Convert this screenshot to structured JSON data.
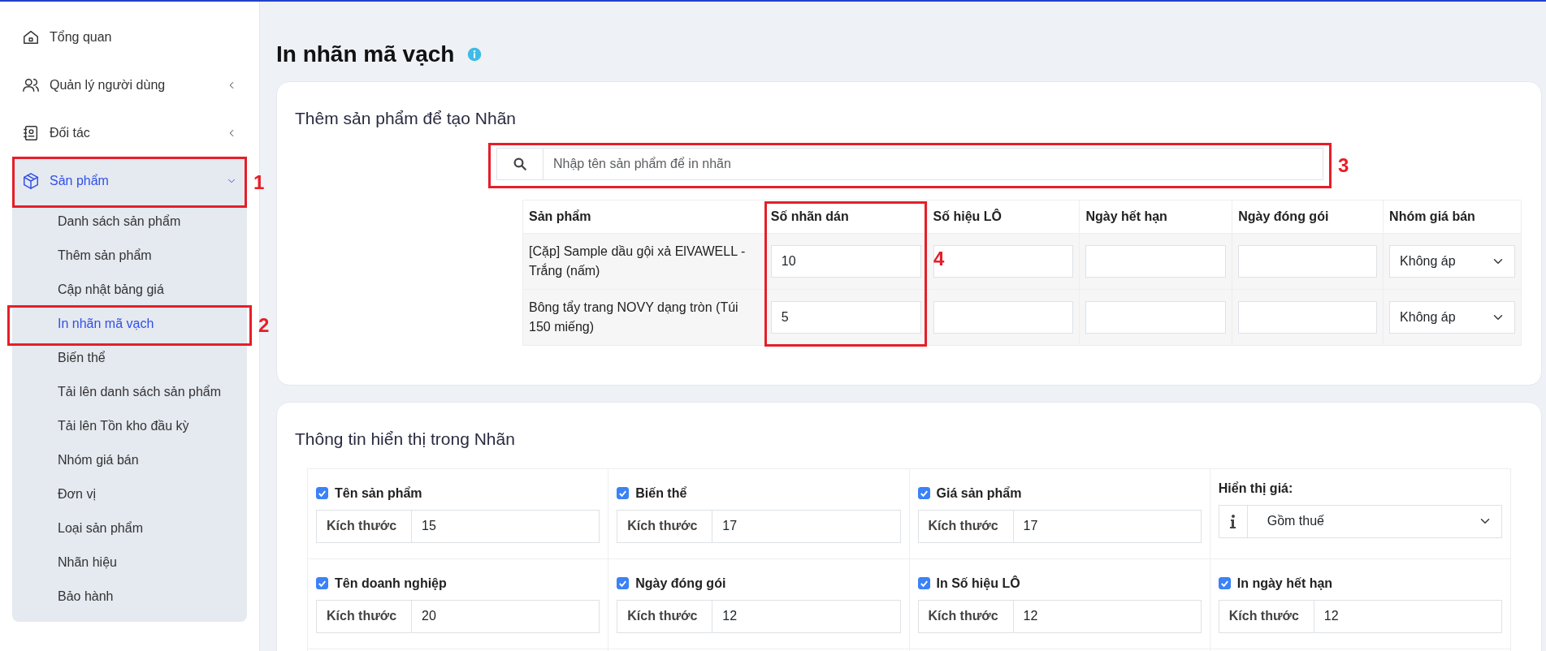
{
  "sidebar": {
    "items": [
      {
        "label": "Tổng quan",
        "selected": false
      },
      {
        "label": "Quản lý người dùng",
        "expanded": false,
        "selected": false
      },
      {
        "label": "Đối tác",
        "expanded": false,
        "selected": false
      },
      {
        "label": "Sản phẩm",
        "expanded": true,
        "selected": true,
        "children": [
          {
            "label": "Danh sách sản phẩm",
            "selected": false
          },
          {
            "label": "Thêm sản phẩm",
            "selected": false
          },
          {
            "label": "Cập nhật bảng giá",
            "selected": false
          },
          {
            "label": "In nhãn mã vạch",
            "selected": true
          },
          {
            "label": "Biến thể",
            "selected": false
          },
          {
            "label": "Tải lên danh sách sản phẩm",
            "selected": false
          },
          {
            "label": "Tải lên Tồn kho đầu kỳ",
            "selected": false
          },
          {
            "label": "Nhóm giá bán",
            "selected": false
          },
          {
            "label": "Đơn vị",
            "selected": false
          },
          {
            "label": "Loại sản phẩm",
            "selected": false
          },
          {
            "label": "Nhãn hiệu",
            "selected": false
          },
          {
            "label": "Bảo hành",
            "selected": false
          }
        ]
      }
    ]
  },
  "page_title": "In nhãn mã vạch",
  "add_products": {
    "title": "Thêm sản phẩm để tạo Nhãn",
    "search": {
      "placeholder": "Nhập tên sản phẩm để in nhãn"
    },
    "table": {
      "columns": [
        "Sản phẩm",
        "Số nhãn dán",
        "Số hiệu LÔ",
        "Ngày hết hạn",
        "Ngày đóng gói",
        "Nhóm giá bán"
      ],
      "rows": [
        {
          "product": "[Cặp] Sample dầu gội xả ElVAWELL - Trắng (nấm)",
          "label_count": "10",
          "price_group": "Không áp"
        },
        {
          "product": "Bông tẩy trang NOVY dạng tròn (Túi 150 miếng)",
          "label_count": "5",
          "price_group": "Không áp"
        }
      ]
    }
  },
  "label_info": {
    "title": "Thông tin hiển thị trong Nhãn",
    "items": [
      {
        "kind": "checkbox",
        "label": "Tên sản phẩm",
        "checked": true,
        "size_label": "Kích thước",
        "size": "15"
      },
      {
        "kind": "checkbox",
        "label": "Biến thể",
        "checked": true,
        "size_label": "Kích thước",
        "size": "17"
      },
      {
        "kind": "checkbox",
        "label": "Giá sản phẩm",
        "checked": true,
        "size_label": "Kích thước",
        "size": "17"
      },
      {
        "kind": "select",
        "label": "Hiển thị giá:",
        "value": "Gồm thuế"
      },
      {
        "kind": "checkbox",
        "label": "Tên doanh nghiệp",
        "checked": true,
        "size_label": "Kích thước",
        "size": "20"
      },
      {
        "kind": "checkbox",
        "label": "Ngày đóng gói",
        "checked": true,
        "size_label": "Kích thước",
        "size": "12"
      },
      {
        "kind": "checkbox",
        "label": "In Số hiệu LÔ",
        "checked": true,
        "size_label": "Kích thước",
        "size": "12"
      },
      {
        "kind": "checkbox",
        "label": "In ngày hết hạn",
        "checked": true,
        "size_label": "Kích thước",
        "size": "12"
      }
    ]
  },
  "annotations": [
    {
      "label": "1"
    },
    {
      "label": "2"
    },
    {
      "label": "3"
    },
    {
      "label": "4"
    }
  ]
}
